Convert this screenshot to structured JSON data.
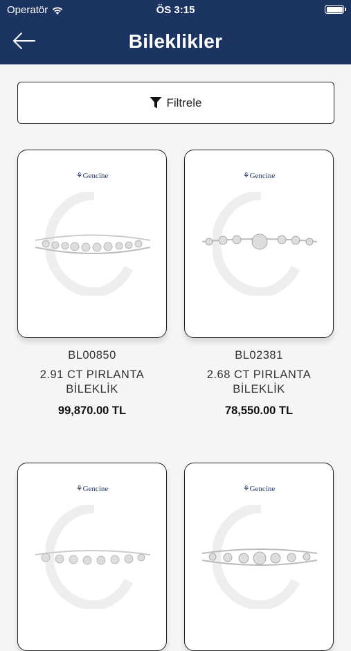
{
  "status_bar": {
    "carrier": "Operatör",
    "time": "ÖS 3:15"
  },
  "header": {
    "title": "Bileklikler"
  },
  "filter": {
    "label": "Filtrele"
  },
  "products": [
    {
      "brand": "Gencine",
      "code": "BL00850",
      "name": "2.91 CT PIRLANTA BİLEKLİK",
      "price": "99,870.00 TL"
    },
    {
      "brand": "Gencine",
      "code": "BL02381",
      "name": "2.68 CT PIRLANTA BİLEKLİK",
      "price": "78,550.00 TL"
    },
    {
      "brand": "Gencine",
      "code": "",
      "name": "",
      "price": ""
    },
    {
      "brand": "Gencine",
      "code": "",
      "name": "",
      "price": ""
    }
  ],
  "colors": {
    "header_bg": "#1c3461",
    "brand": "#1c3461",
    "page_bg": "#f5f5f5"
  }
}
